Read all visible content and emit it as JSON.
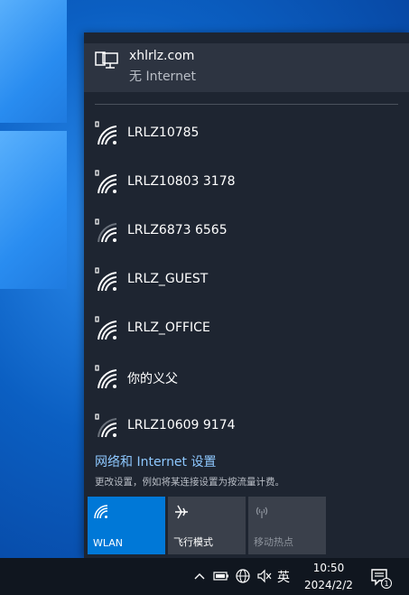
{
  "connected": {
    "name": "xhlrlz.com",
    "status": "无 Internet"
  },
  "networks": [
    {
      "name": "LRLZ10785",
      "secured": true
    },
    {
      "name": "LRLZ10803 3178",
      "secured": true
    },
    {
      "name": "LRLZ6873 6565",
      "secured": true
    },
    {
      "name": "LRLZ_GUEST",
      "secured": true
    },
    {
      "name": "LRLZ_OFFICE",
      "secured": true
    },
    {
      "name": "你的义父",
      "secured": true
    },
    {
      "name": "LRLZ10609 9174",
      "secured": true
    }
  ],
  "settings": {
    "link": "网络和 Internet 设置",
    "description": "更改设置，例如将某连接设置为按流量计费。"
  },
  "quick_actions": {
    "wlan": "WLAN",
    "airplane": "飞行模式",
    "hotspot": "移动热点"
  },
  "taskbar": {
    "language": "英",
    "time": "10:50",
    "date": "2024/2/2",
    "notification_count": "1"
  },
  "colors": {
    "accent": "#0078d7",
    "flyout": "#1e2531",
    "link": "#8ec8ff"
  }
}
